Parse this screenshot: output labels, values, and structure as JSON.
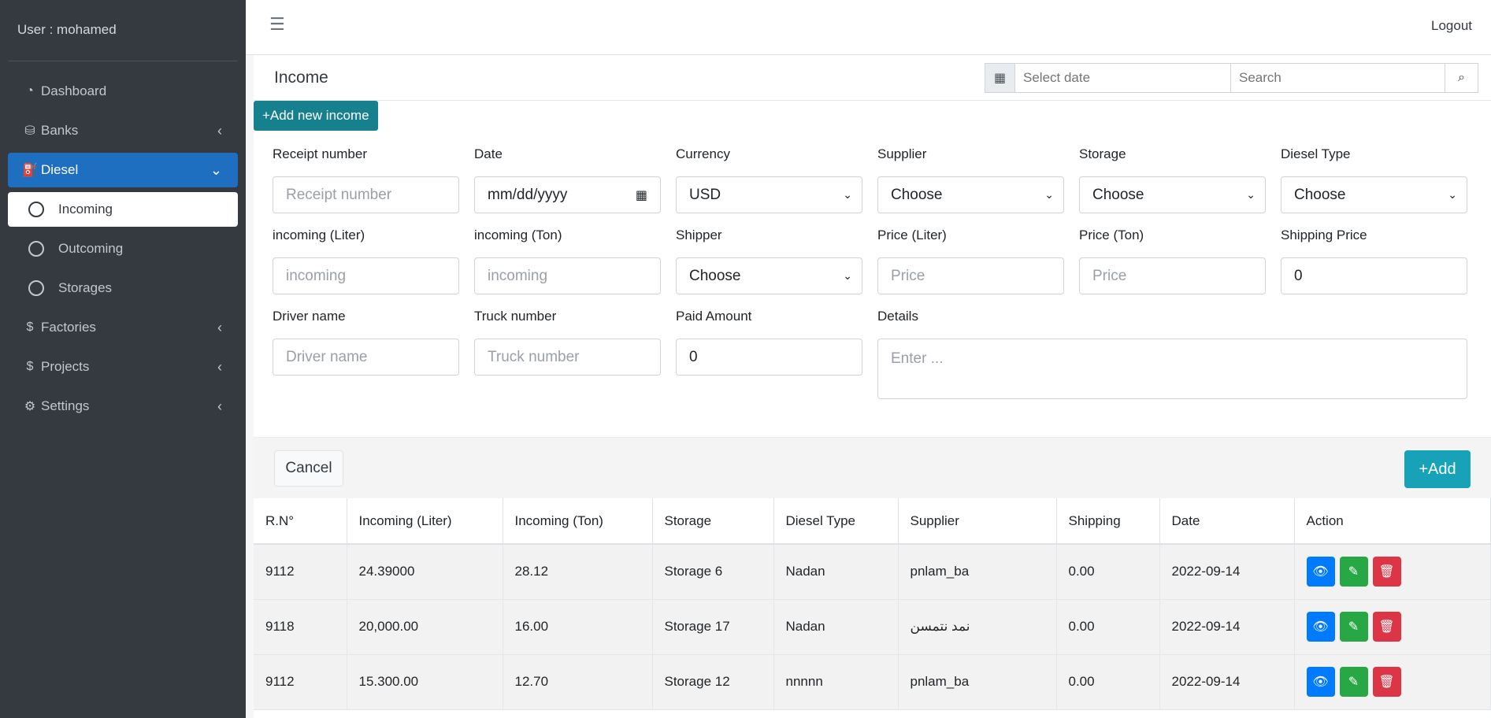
{
  "sidebar": {
    "user": "User : mohamed",
    "items": [
      {
        "label": "Dashboard",
        "icon": "dashboard-icon"
      },
      {
        "label": "Banks",
        "icon": "bank-icon"
      },
      {
        "label": "Diesel",
        "icon": "fuel-icon"
      },
      {
        "label": "Factories",
        "icon": "dollar-icon"
      },
      {
        "label": "Projects",
        "icon": "dollar-icon"
      },
      {
        "label": "Settings",
        "icon": "gear-icon"
      }
    ],
    "diesel_sub": [
      "Incoming",
      "Outcoming",
      "Storages"
    ]
  },
  "topbar": {
    "logout": "Logout"
  },
  "card": {
    "title": "Income",
    "date_placeholder": "Select date",
    "search_placeholder": "Search",
    "add_new": "+Add new income"
  },
  "form": {
    "receipt": {
      "label": "Receipt number",
      "placeholder": "Receipt number"
    },
    "date": {
      "label": "Date",
      "value": "mm/dd/yyyy"
    },
    "currency": {
      "label": "Currency",
      "value": "USD"
    },
    "supplier": {
      "label": "Supplier",
      "value": "Choose"
    },
    "storage": {
      "label": "Storage",
      "value": "Choose"
    },
    "diesel_type": {
      "label": "Diesel Type",
      "value": "Choose"
    },
    "incoming_liter": {
      "label": "incoming (Liter)",
      "placeholder": "incoming"
    },
    "incoming_ton": {
      "label": "incoming (Ton)",
      "placeholder": "incoming"
    },
    "shipper": {
      "label": "Shipper",
      "value": "Choose"
    },
    "price_liter": {
      "label": "Price (Liter)",
      "placeholder": "Price"
    },
    "price_ton": {
      "label": "Price (Ton)",
      "placeholder": "Price"
    },
    "shipping_price": {
      "label": "Shipping Price",
      "value": "0"
    },
    "driver": {
      "label": "Driver name",
      "placeholder": "Driver name"
    },
    "truck": {
      "label": "Truck number",
      "placeholder": "Truck number"
    },
    "paid": {
      "label": "Paid Amount",
      "value": "0"
    },
    "details": {
      "label": "Details",
      "placeholder": "Enter ..."
    }
  },
  "buttons": {
    "cancel": "Cancel",
    "add": "+Add"
  },
  "table": {
    "headers": [
      "R.N°",
      "Incoming (Liter)",
      "Incoming (Ton)",
      "Storage",
      "Diesel Type",
      "Supplier",
      "Shipping",
      "Date",
      "Action"
    ],
    "rows": [
      {
        "rn": "9112",
        "liter": "24.39000",
        "ton": "28.12",
        "storage": "Storage 6",
        "type": "Nadan",
        "supplier": "pnlam_ba",
        "shipping": "0.00",
        "date": "2022-09-14"
      },
      {
        "rn": "9118",
        "liter": "20,000.00",
        "ton": "16.00",
        "storage": "Storage 17",
        "type": "Nadan",
        "supplier": "نمد نتمسن",
        "shipping": "0.00",
        "date": "2022-09-14"
      },
      {
        "rn": "9112",
        "liter": "15.300.00",
        "ton": "12.70",
        "storage": "Storage 12",
        "type": "nnnnn",
        "supplier": "pnlam_ba",
        "shipping": "0.00",
        "date": "2022-09-14"
      }
    ]
  }
}
